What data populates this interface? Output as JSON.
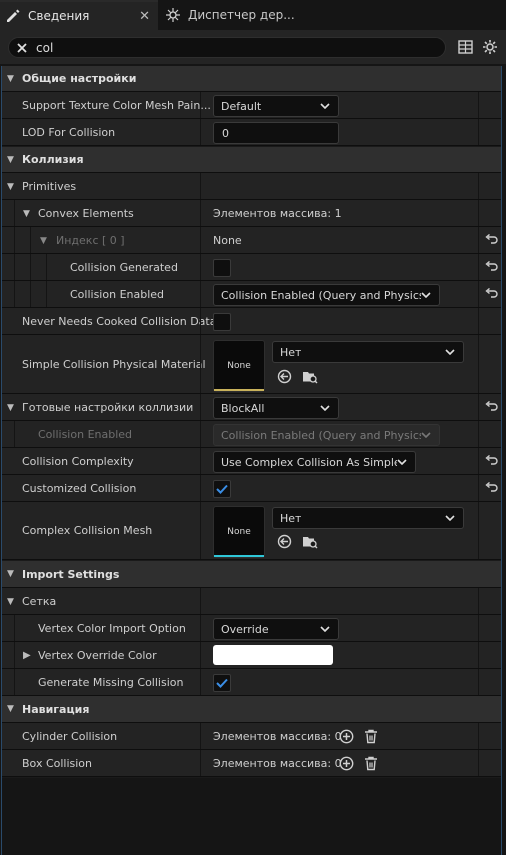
{
  "tabs": [
    {
      "label": "Сведения",
      "close": "✕"
    },
    {
      "label": "Диспетчер дер..."
    }
  ],
  "search": {
    "value": "col"
  },
  "sections": {
    "general": "Общие настройки",
    "collision": "Коллизия",
    "import": "Import Settings",
    "mesh": "Сетка",
    "navigation": "Навигация"
  },
  "props": {
    "support_texture": {
      "label": "Support Texture Color Mesh Pain...",
      "value": "Default"
    },
    "lod_collision": {
      "label": "LOD For Collision",
      "value": "0"
    },
    "primitives": {
      "label": "Primitives"
    },
    "convex_elements": {
      "label": "Convex Elements",
      "value": "Элементов массива: 1"
    },
    "index": {
      "label": "Индекс [ 0 ]",
      "value": "None"
    },
    "collision_generated": {
      "label": "Collision Generated"
    },
    "collision_enabled": {
      "label": "Collision Enabled",
      "value": "Collision Enabled (Query and Physics)"
    },
    "never_cooked": {
      "label": "Never Needs Cooked Collision Data"
    },
    "simple_phys_mat": {
      "label": "Simple Collision Physical Material",
      "thumb": "None",
      "value": "Нет"
    },
    "presets": {
      "label": "Готовые настройки коллизии",
      "value": "BlockAll"
    },
    "preset_collision_enabled": {
      "label": "Collision Enabled",
      "value": "Collision Enabled (Query and Physics)"
    },
    "complexity": {
      "label": "Collision Complexity",
      "value": "Use Complex Collision As Simple"
    },
    "customized": {
      "label": "Customized Collision"
    },
    "complex_mesh": {
      "label": "Complex Collision Mesh",
      "thumb": "None",
      "value": "Нет"
    },
    "vertex_color_import": {
      "label": "Vertex Color Import Option",
      "value": "Override"
    },
    "vertex_override": {
      "label": "Vertex Override Color"
    },
    "generate_missing": {
      "label": "Generate Missing Collision"
    },
    "cylinder": {
      "label": "Cylinder Collision",
      "value": "Элементов массива: 0"
    },
    "box": {
      "label": "Box Collision",
      "value": "Элементов массива: 0"
    }
  },
  "colors": {
    "accent": "#2a79d8",
    "checkmark": "#3a8ee6",
    "thumb_yellow": "#c9b25b",
    "thumb_cyan": "#2fc7d8"
  }
}
